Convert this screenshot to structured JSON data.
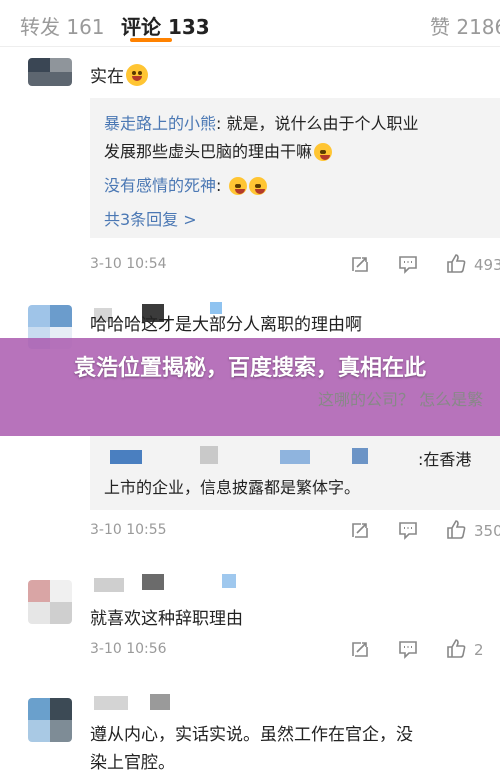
{
  "tabs": {
    "repost": "转发 161",
    "comment": "评论 133",
    "like": "赞 2186"
  },
  "banner": {
    "title": "袁浩位置揭秘，百度搜索，真相在此"
  },
  "comments": [
    {
      "text": "实在",
      "reply": {
        "line1_name": "暴走路上的小熊",
        "line1_text": ": 就是，说什么由于个人职业",
        "line2_text": "发展那些虚头巴脑的理由干嘛",
        "line3_name": "没有感情的死神",
        "line3_text": ":",
        "more": "共3条回复 >"
      },
      "time": "3-10 10:54",
      "likes": "493"
    },
    {
      "text": "哈哈哈这才是大部分人离职的理由啊",
      "reply": {
        "line1_text": "这哪的公司？ 怎么是繁",
        "line2_name_tail": ":在香港",
        "line3_text": "上市的企业，信息披露都是繁体字。"
      },
      "time": "3-10 10:55",
      "likes": "350"
    },
    {
      "text": "就喜欢这种辞职理由",
      "time": "3-10 10:56",
      "likes": "2"
    },
    {
      "text_line1": "遵从内心，实话实说。虽然工作在官企，没",
      "text_line2": "染上官腔。"
    }
  ],
  "icons": {
    "repost": "repost-icon",
    "reply": "reply-icon",
    "like": "thumbs-up-icon"
  }
}
